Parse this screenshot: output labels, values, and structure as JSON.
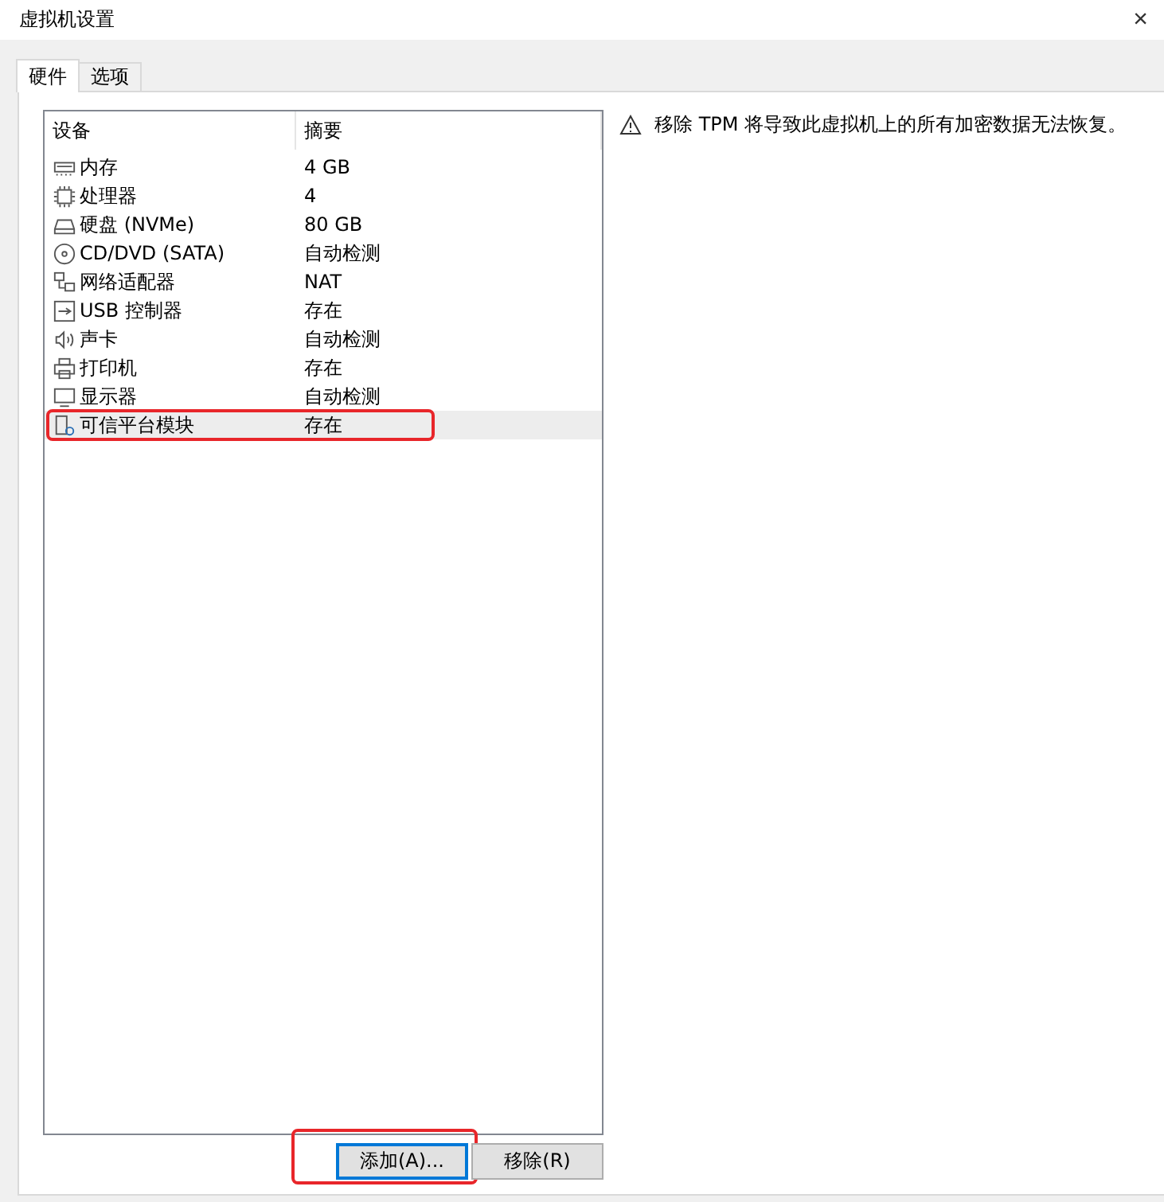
{
  "window": {
    "title": "虚拟机设置",
    "close": "×"
  },
  "tabs": [
    {
      "label": "硬件",
      "selected": true
    },
    {
      "label": "选项",
      "selected": false
    }
  ],
  "devices": {
    "columns": [
      "设备",
      "摘要"
    ],
    "rows": [
      {
        "device": "内存",
        "summary": "4 GB",
        "selected": false,
        "annotated": false
      },
      {
        "device": "处理器",
        "summary": "4",
        "selected": false,
        "annotated": false
      },
      {
        "device": "硬盘 (NVMe)",
        "summary": "80 GB",
        "selected": false,
        "annotated": false
      },
      {
        "device": "CD/DVD (SATA)",
        "summary": "自动检测",
        "selected": false,
        "annotated": false
      },
      {
        "device": "网络适配器",
        "summary": "NAT",
        "selected": false,
        "annotated": false
      },
      {
        "device": "USB 控制器",
        "summary": "存在",
        "selected": false,
        "annotated": false
      },
      {
        "device": "声卡",
        "summary": "自动检测",
        "selected": false,
        "annotated": false
      },
      {
        "device": "打印机",
        "summary": "存在",
        "selected": false,
        "annotated": false
      },
      {
        "device": "显示器",
        "summary": "自动检测",
        "selected": false,
        "annotated": false
      },
      {
        "device": "可信平台模块",
        "summary": "存在",
        "selected": true,
        "annotated": true
      }
    ]
  },
  "buttons": [
    {
      "label": "添加(A)...",
      "focused": true,
      "annotated": true
    },
    {
      "label": "移除(R)",
      "focused": false,
      "annotated": false
    }
  ],
  "warning": "移除 TPM 将导致此虚拟机上的所有加密数据无法恢复。"
}
